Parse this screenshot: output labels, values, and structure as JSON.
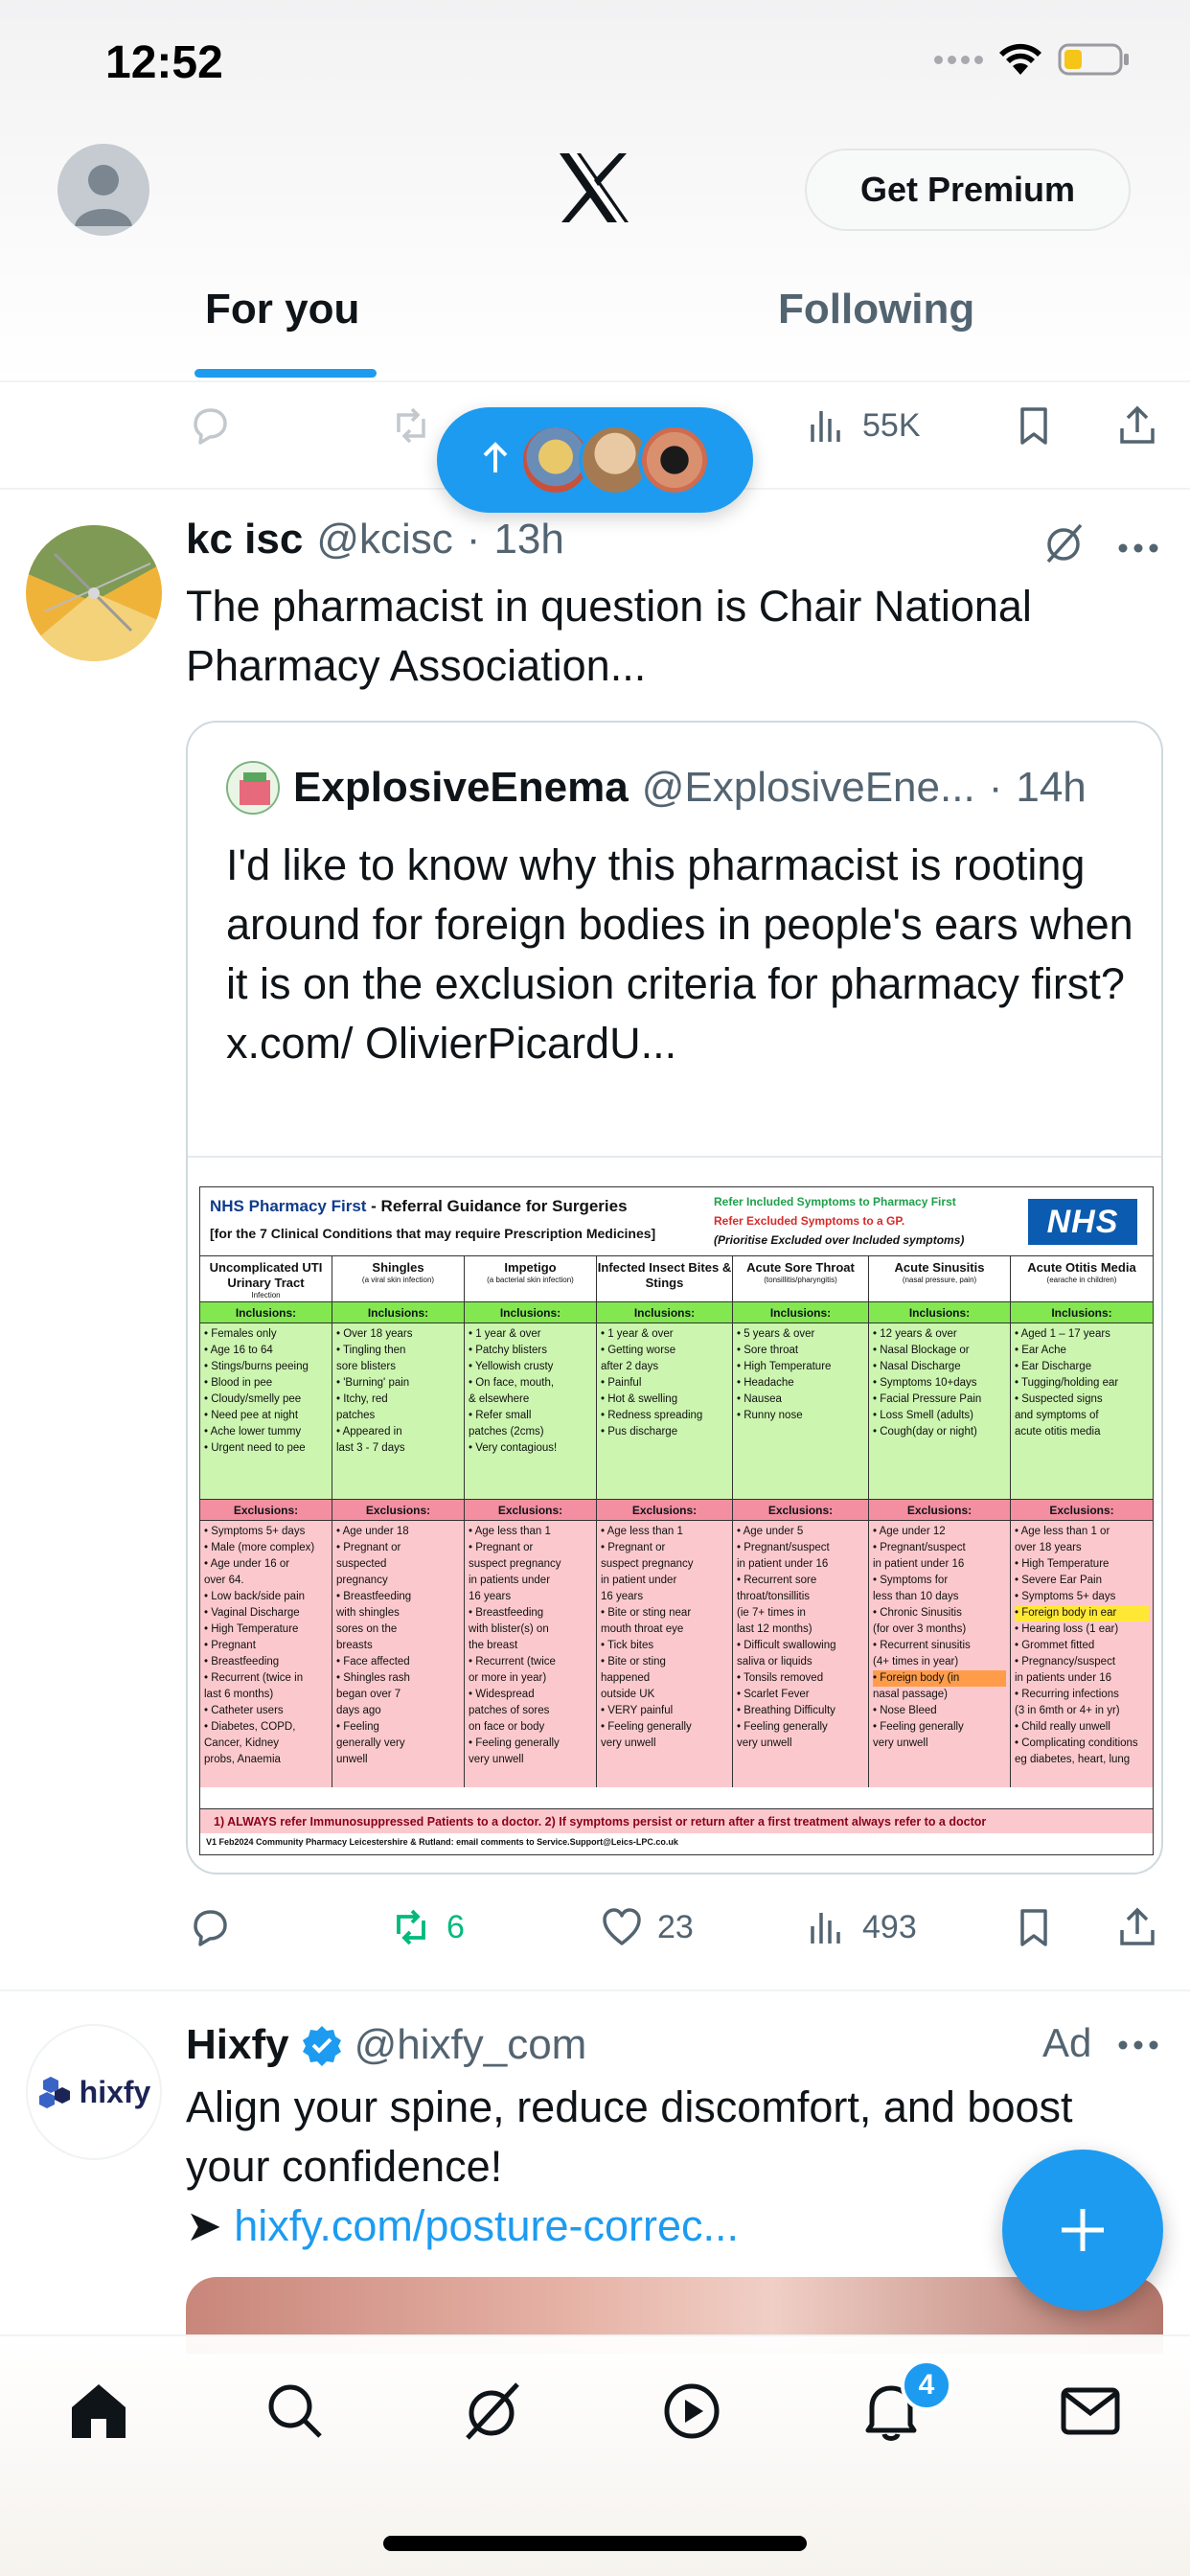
{
  "status_bar": {
    "time": "12:52"
  },
  "header": {
    "premium_label": "Get Premium"
  },
  "tabs": [
    {
      "label": "For you",
      "active": true
    },
    {
      "label": "Following",
      "active": false
    }
  ],
  "prev_tweet_actions": {
    "views": "55K"
  },
  "new_posts_pill": {
    "avatars": [
      "avatar-1",
      "avatar-2",
      "avatar-3"
    ]
  },
  "tweet": {
    "name": "kc isc",
    "handle": "@kcisc",
    "dot": "·",
    "time": "13h",
    "text": "The pharmacist in question is Chair National Pharmacy Association...",
    "quote": {
      "name": "ExplosiveEnema",
      "handle": "@ExplosiveEne...",
      "dot": "·",
      "time": "14h",
      "text": "I'd like to know why this pharmacist is rooting around for foreign bodies in people's ears when it is on the exclusion criteria for pharmacy first? x.com/ OlivierPicardU...",
      "infographic": {
        "title_blue": "NHS Pharmacy First",
        "title_black": " - Referral Guidance for Surgeries",
        "subtitle": "[for the 7 Clinical Conditions that may require Prescription Medicines]",
        "legend_included": "Refer Included Symptoms to Pharmacy First",
        "legend_excluded": "Refer Excluded Symptoms to a GP.",
        "legend_priority": "(Prioritise Excluded over Included symptoms)",
        "logo": "NHS",
        "inclusions_label": "Inclusions:",
        "exclusions_label": "Exclusions:",
        "columns": [
          {
            "title": "Uncomplicated UTI Urinary Tract",
            "sub": "Infection",
            "inclusions": [
              "• Females only",
              "• Age 16 to 64",
              "• Stings/burns peeing",
              "• Blood in pee",
              "• Cloudy/smelly pee",
              "• Need pee at night",
              "• Ache lower tummy",
              "• Urgent need to pee"
            ],
            "exclusions": [
              "• Symptoms 5+ days",
              "• Male (more complex)",
              "• Age under 16 or",
              "  over 64.",
              "• Low back/side pain",
              "• Vaginal Discharge",
              "• High Temperature",
              "• Pregnant",
              "• Breastfeeding",
              "• Recurrent (twice in",
              "  last 6 months)",
              "• Catheter users",
              "• Diabetes, COPD,",
              "  Cancer, Kidney",
              "  probs, Anaemia"
            ]
          },
          {
            "title": "Shingles",
            "sub": "(a viral skin infection)",
            "inclusions": [
              "• Over 18 years",
              "• Tingling then",
              "  sore blisters",
              "• 'Burning' pain",
              "• Itchy, red",
              "  patches",
              "• Appeared in",
              "  last 3 - 7 days"
            ],
            "exclusions": [
              "• Age under 18",
              "• Pregnant or",
              "  suspected",
              "  pregnancy",
              "• Breastfeeding",
              "  with shingles",
              "  sores on the",
              "  breasts",
              "• Face affected",
              "• Shingles rash",
              "  began over 7",
              "  days ago",
              "• Feeling",
              "  generally very",
              "  unwell"
            ]
          },
          {
            "title": "Impetigo",
            "sub": "(a bacterial skin infection)",
            "inclusions": [
              "• 1 year & over",
              "• Patchy blisters",
              "• Yellowish crusty",
              "• On face, mouth,",
              "  & elsewhere",
              "• Refer small",
              "  patches (2cms)",
              "• Very contagious!"
            ],
            "exclusions": [
              "• Age less than 1",
              "• Pregnant or",
              "  suspect pregnancy",
              "  in patients under",
              "  16 years",
              "• Breastfeeding",
              "  with blister(s) on",
              "  the breast",
              "• Recurrent (twice",
              "  or more in year)",
              "• Widespread",
              "  patches of sores",
              "  on face or body",
              "• Feeling generally",
              "  very unwell"
            ]
          },
          {
            "title": "Infected Insect Bites & Stings",
            "sub": "",
            "inclusions": [
              "• 1 year & over",
              "• Getting worse",
              "  after 2 days",
              "• Painful",
              "• Hot & swelling",
              "• Redness spreading",
              "• Pus discharge"
            ],
            "exclusions": [
              "• Age less than 1",
              "• Pregnant or",
              "  suspect pregnancy",
              "  in patient under",
              "  16 years",
              "• Bite or sting near",
              "  mouth throat eye",
              "• Tick bites",
              "• Bite or sting",
              "  happened",
              "  outside UK",
              "• VERY painful",
              "• Feeling generally",
              "  very unwell"
            ]
          },
          {
            "title": "Acute Sore Throat",
            "sub": "(tonsillitis/pharyngitis)",
            "inclusions": [
              "• 5 years & over",
              "• Sore throat",
              "• High Temperature",
              "• Headache",
              "• Nausea",
              "• Runny nose"
            ],
            "exclusions": [
              "• Age under 5",
              "• Pregnant/suspect",
              "  in patient under 16",
              "• Recurrent sore",
              "  throat/tonsillitis",
              "  (ie 7+ times in",
              "  last 12 months)",
              "• Difficult swallowing",
              "  saliva or liquids",
              "• Tonsils removed",
              "• Scarlet Fever",
              "• Breathing Difficulty",
              "• Feeling generally",
              "  very unwell"
            ]
          },
          {
            "title": "Acute Sinusitis",
            "sub": "(nasal pressure, pain)",
            "inclusions": [
              "• 12 years & over",
              "• Nasal Blockage or",
              "• Nasal Discharge",
              "• Symptoms 10+days",
              "• Facial Pressure Pain",
              "• Loss Smell (adults)",
              "• Cough(day or night)"
            ],
            "exclusions": [
              "• Age under 12",
              "• Pregnant/suspect",
              "  in patient under 16",
              "• Symptoms for",
              "  less than 10 days",
              "• Chronic Sinusitis",
              "  (for over 3 months)",
              "• Recurrent sinusitis",
              "  (4+ times in year)",
              "• Foreign body (in",
              "  nasal passage)",
              "• Nose Bleed",
              "• Feeling generally",
              "  very unwell"
            ]
          },
          {
            "title": "Acute Otitis Media",
            "sub": "(earache in children)",
            "inclusions": [
              "• Aged 1 – 17 years",
              "• Ear Ache",
              "• Ear Discharge",
              "• Tugging/holding ear",
              "• Suspected signs",
              "  and symptoms of",
              "  acute otitis media"
            ],
            "exclusions": [
              "• Age less than 1 or",
              "  over 18 years",
              "• High Temperature",
              "• Severe Ear Pain",
              "• Symptoms 5+ days",
              "• Foreign body in ear",
              "• Hearing loss (1 ear)",
              "• Grommet fitted",
              "• Pregnancy/suspect",
              "  in patients under 16",
              "• Recurring infections",
              "  (3 in 6mth or 4+ in yr)",
              "• Child really unwell",
              "• Complicating conditions",
              "  eg diabetes, heart, lung"
            ]
          }
        ],
        "footer_note": "1) ALWAYS refer Immunosuppressed Patients to a doctor.    2) If symptoms persist or return after a first treatment always refer to a doctor",
        "footer_credit": "V1 Feb2024 Community Pharmacy Leicestershire & Rutland: email comments to Service.Support@Leics-LPC.co.uk"
      }
    },
    "actions": {
      "retweets": "6",
      "likes": "23",
      "views": "493"
    }
  },
  "ad": {
    "name": "Hixfy",
    "handle": "@hixfy_com",
    "label": "Ad",
    "logo_text": "hixfy",
    "text": "Align your spine, reduce discomfort, and boost your confidence!",
    "link_prefix": "➤ ",
    "link": "hixfy.com/posture-correc..."
  },
  "bottom_nav": {
    "items": [
      "home-icon",
      "search-icon",
      "grok-icon",
      "video-icon",
      "notifications-icon",
      "messages-icon"
    ],
    "notifications_badge": "4"
  },
  "colors": {
    "accent": "#1d9bf0",
    "retweet_green": "#00ba7c",
    "secondary_text": "#536471"
  }
}
